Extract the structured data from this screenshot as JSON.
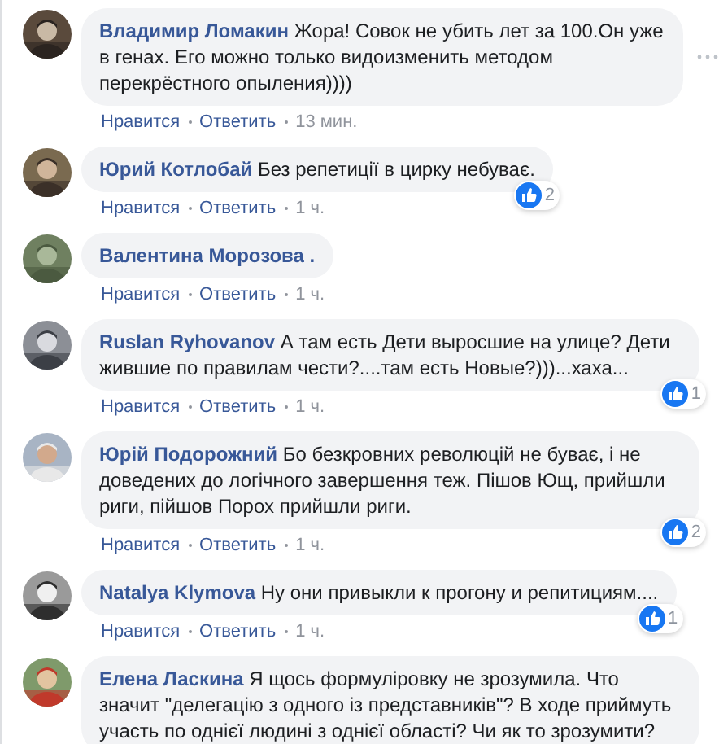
{
  "comments": [
    {
      "author": "Владимир Ломакин",
      "text": "Жора! Совок не убить лет за 100.Он уже в генах. Его можно только видоизменить методом перекрёстного опыления))))",
      "like": "Нравится",
      "reply": "Ответить",
      "time": "13 мин.",
      "menu_shown": true
    },
    {
      "author": "Юрий Котлобай",
      "text": "Без репетиції в цирку небуває.",
      "like": "Нравится",
      "reply": "Ответить",
      "time": "1 ч.",
      "reactions": "2",
      "menu_shown": false
    },
    {
      "author": "Валентина Морозова .",
      "like": "Нравится",
      "reply": "Ответить",
      "time": "1 ч.",
      "menu_shown": false
    },
    {
      "author": "Ruslan Ryhovanov",
      "text": "А там есть Дети выросшие на улице? Дети жившие по правилам чести?....там есть Новые?)))...хаха...",
      "like": "Нравится",
      "reply": "Ответить",
      "time": "1 ч.",
      "reactions": "1",
      "menu_shown": false
    },
    {
      "author": "Юрій Подорожний",
      "text": "Бо безкровних революцій не буває, і не доведених до логічного завершення теж. Пішов Ющ, прийшли риги, пійшов Порох прийшли риги.",
      "like": "Нравится",
      "reply": "Ответить",
      "time": "1 ч.",
      "reactions": "2",
      "menu_shown": false
    },
    {
      "author": "Natalya Klymova",
      "text": "Ну они привыкли к прогону и репитициям....",
      "like": "Нравится",
      "reply": "Ответить",
      "time": "1 ч.",
      "reactions": "1",
      "menu_shown": false
    },
    {
      "author": "Елена Ласкина",
      "text": "Я щось формуліровку не зрозумила. Что значит \"делегацію з одного із представників\"? В ходе приймуть участь по однієї людині з однієї області? Чи як то зрозумити?",
      "menu_shown": false
    }
  ]
}
